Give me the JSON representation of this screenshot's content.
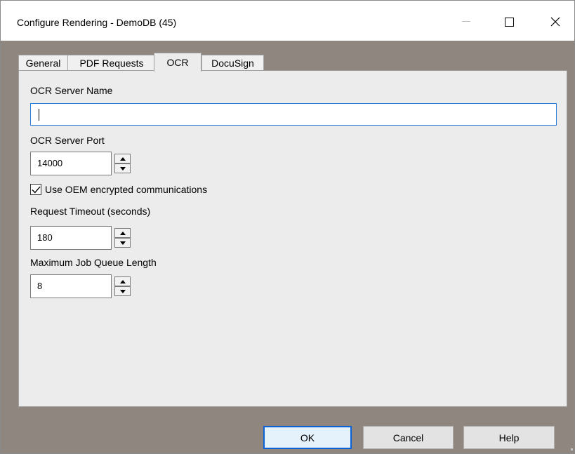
{
  "window": {
    "title": "Configure Rendering - DemoDB (45)",
    "controls": {
      "minimize": "minimize-icon",
      "maximize": "maximize-icon",
      "close": "close-icon"
    }
  },
  "tabs": [
    {
      "label": "General",
      "active": false
    },
    {
      "label": "PDF Requests",
      "active": false
    },
    {
      "label": "OCR",
      "active": true
    },
    {
      "label": "DocuSign",
      "active": false
    }
  ],
  "ocr": {
    "server_name_label": "OCR Server Name",
    "server_name_value": "",
    "server_port_label": "OCR Server Port",
    "server_port_value": "14000",
    "use_oem_label": "Use OEM encrypted communications",
    "use_oem_checked": true,
    "timeout_label": "Request Timeout (seconds)",
    "timeout_value": "180",
    "queue_label": "Maximum Job Queue Length",
    "queue_value": "8"
  },
  "buttons": {
    "ok": "OK",
    "cancel": "Cancel",
    "help": "Help"
  },
  "colors": {
    "focus_border": "#2f80d5",
    "default_button_border": "#0a63d6",
    "frame_background": "#8f8680"
  }
}
